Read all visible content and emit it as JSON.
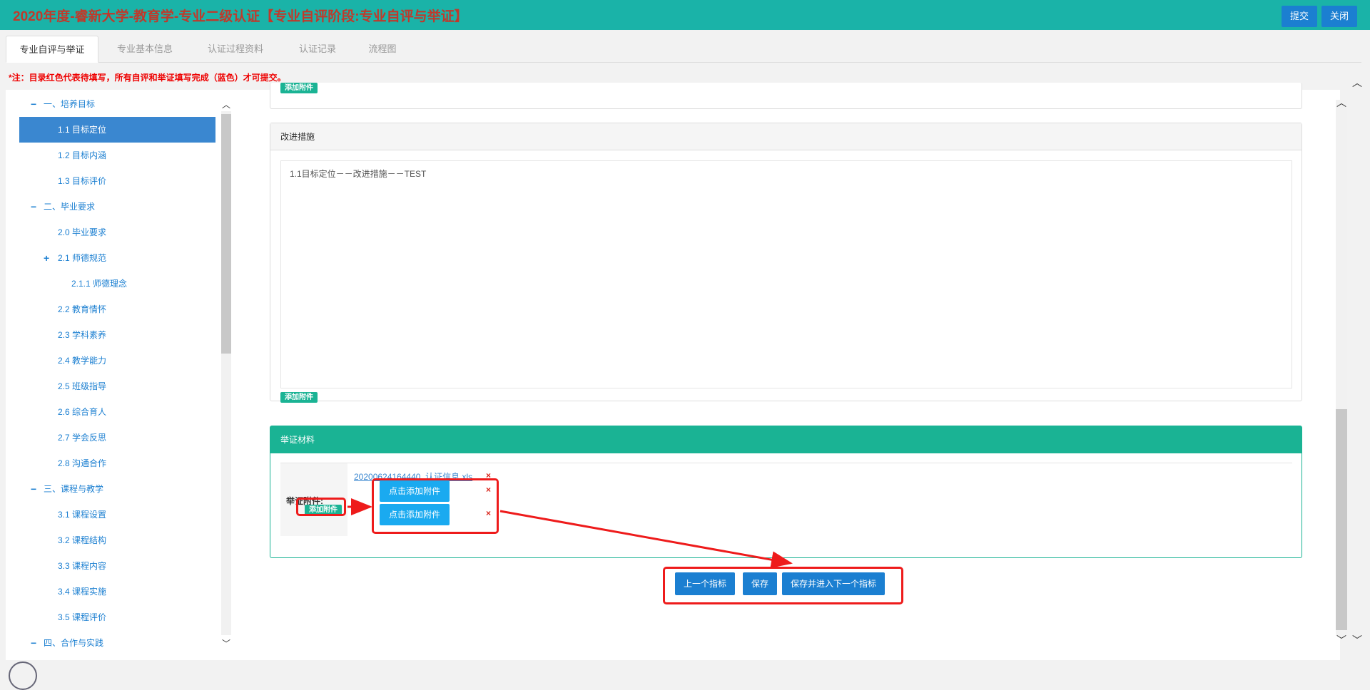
{
  "header": {
    "title": "2020年度-睿新大学-教育学-专业二级认证【专业自评阶段:专业自评与举证】",
    "submit_label": "提交",
    "close_label": "关闭"
  },
  "tabs": [
    {
      "label": "专业自评与举证",
      "active": true
    },
    {
      "label": "专业基本信息",
      "active": false
    },
    {
      "label": "认证过程资料",
      "active": false
    },
    {
      "label": "认证记录",
      "active": false
    },
    {
      "label": "流程图",
      "active": false
    }
  ],
  "notice": "*注：目录红色代表待填写，所有自评和举证填写完成（蓝色）才可提交。",
  "sidebar": {
    "items": [
      {
        "label": "一、培养目标",
        "level": 0,
        "toggle": "−"
      },
      {
        "label": "1.1 目标定位",
        "level": 1,
        "active": true
      },
      {
        "label": "1.2 目标内涵",
        "level": 1
      },
      {
        "label": "1.3 目标评价",
        "level": 1
      },
      {
        "label": "二、毕业要求",
        "level": 0,
        "toggle": "−"
      },
      {
        "label": "2.0 毕业要求",
        "level": 1
      },
      {
        "label": "2.1 师德规范",
        "level": 1,
        "toggle": "+"
      },
      {
        "label": "2.1.1 师德理念",
        "level": 2
      },
      {
        "label": "2.2 教育情怀",
        "level": 1
      },
      {
        "label": "2.3 学科素养",
        "level": 1
      },
      {
        "label": "2.4 教学能力",
        "level": 1
      },
      {
        "label": "2.5 班级指导",
        "level": 1
      },
      {
        "label": "2.6 综合育人",
        "level": 1
      },
      {
        "label": "2.7 学会反思",
        "level": 1
      },
      {
        "label": "2.8 沟通合作",
        "level": 1
      },
      {
        "label": "三、课程与教学",
        "level": 0,
        "toggle": "−"
      },
      {
        "label": "3.1 课程设置",
        "level": 1
      },
      {
        "label": "3.2 课程结构",
        "level": 1
      },
      {
        "label": "3.3 课程内容",
        "level": 1
      },
      {
        "label": "3.4 课程实施",
        "level": 1
      },
      {
        "label": "3.5 课程评价",
        "level": 1
      },
      {
        "label": "四、合作与实践",
        "level": 0,
        "toggle": "−"
      }
    ]
  },
  "top_panel": {
    "add_attachment_label": "添加附件"
  },
  "improvement_panel": {
    "title": "改进措施",
    "content": "1.1目标定位－－改进措施－－TEST",
    "add_attachment_label": "添加附件"
  },
  "evidence_panel": {
    "title": "举证材料",
    "attachment_label": "举证附件:",
    "add_attachment_label": "添加附件",
    "file_name": "20200624164440_认证信息.xls",
    "add_file_button_label": "点击添加附件",
    "delete_icon": "×"
  },
  "actions": {
    "prev_label": "上一个指标",
    "save_label": "保存",
    "save_next_label": "保存并进入下一个指标"
  },
  "colors": {
    "header_bg": "#1ab3a8",
    "title_text": "#c0392b",
    "primary_button": "#1b7fd1",
    "green_accent": "#1ab394",
    "add_file_button": "#1aaaf0",
    "highlight": "#ee1b1b",
    "tree_active": "#3a87d0"
  }
}
